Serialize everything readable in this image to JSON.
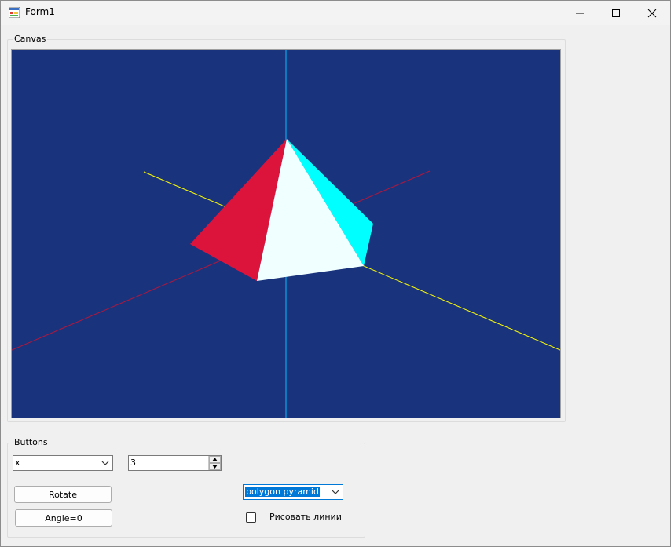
{
  "window": {
    "title": "Form1"
  },
  "canvas_group": {
    "label": "Canvas"
  },
  "buttons_group": {
    "label": "Buttons"
  },
  "axis_combo": {
    "value": "x"
  },
  "numeric": {
    "value": "3"
  },
  "rotate_button": {
    "label": "Rotate"
  },
  "angle_button": {
    "label": "Angle=0"
  },
  "shape_combo": {
    "value": "polygon pyramid"
  },
  "lines_checkbox": {
    "label": "Рисовать линии",
    "checked": false
  },
  "colors": {
    "canvas_bg": "#1a337d",
    "face_left": "#dc143c",
    "face_front": "#f0ffff",
    "face_right": "#00ffff",
    "axis_vertical": "#00bfff",
    "axis_red": "#b5163a",
    "axis_yellow": "#ffff00"
  }
}
